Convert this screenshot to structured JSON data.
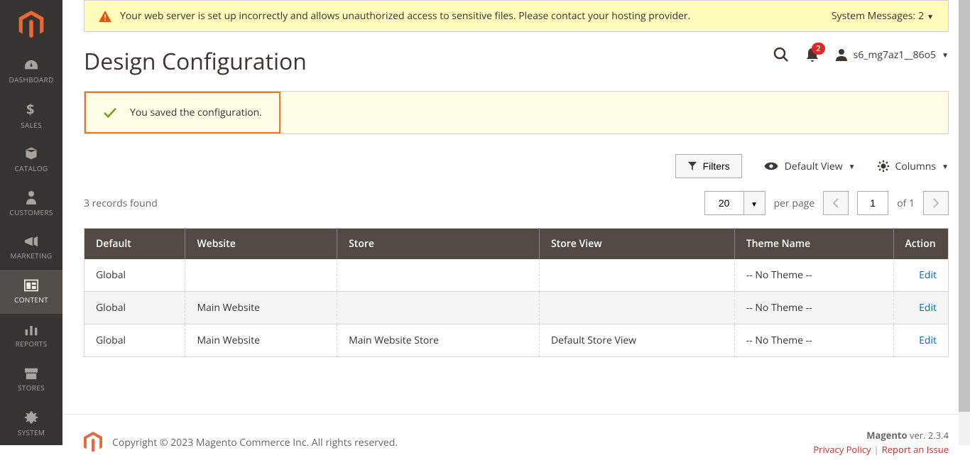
{
  "sidebar": {
    "items": [
      {
        "label": "DASHBOARD",
        "name": "dashboard"
      },
      {
        "label": "SALES",
        "name": "sales"
      },
      {
        "label": "CATALOG",
        "name": "catalog"
      },
      {
        "label": "CUSTOMERS",
        "name": "customers"
      },
      {
        "label": "MARKETING",
        "name": "marketing"
      },
      {
        "label": "CONTENT",
        "name": "content"
      },
      {
        "label": "REPORTS",
        "name": "reports"
      },
      {
        "label": "STORES",
        "name": "stores"
      },
      {
        "label": "SYSTEM",
        "name": "system"
      }
    ]
  },
  "system_message": {
    "text": "Your web server is set up incorrectly and allows unauthorized access to sensitive files. Please contact your hosting provider.",
    "count_label": "System Messages:",
    "count": "2"
  },
  "page_title": "Design Configuration",
  "header": {
    "notif_count": "2",
    "username": "s6_mg7az1__86o5"
  },
  "success": {
    "message": "You saved the configuration."
  },
  "toolbar": {
    "filters": "Filters",
    "default_view": "Default View",
    "columns": "Columns"
  },
  "records": {
    "found": "3 records found",
    "per_page_value": "20",
    "per_page_label": "per page",
    "page_value": "1",
    "of_label": "of",
    "total_pages": "1"
  },
  "table": {
    "headers": [
      "Default",
      "Website",
      "Store",
      "Store View",
      "Theme Name",
      "Action"
    ],
    "rows": [
      {
        "default": "Global",
        "website": "",
        "store": "",
        "store_view": "",
        "theme": "-- No Theme --",
        "action": "Edit"
      },
      {
        "default": "Global",
        "website": "Main Website",
        "store": "",
        "store_view": "",
        "theme": "-- No Theme --",
        "action": "Edit"
      },
      {
        "default": "Global",
        "website": "Main Website",
        "store": "Main Website Store",
        "store_view": "Default Store View",
        "theme": "-- No Theme --",
        "action": "Edit"
      }
    ]
  },
  "footer": {
    "copyright": "Copyright © 2023 Magento Commerce Inc. All rights reserved.",
    "version_label": "Magento",
    "version": "ver. 2.3.4",
    "privacy": "Privacy Policy",
    "report": "Report an Issue"
  }
}
